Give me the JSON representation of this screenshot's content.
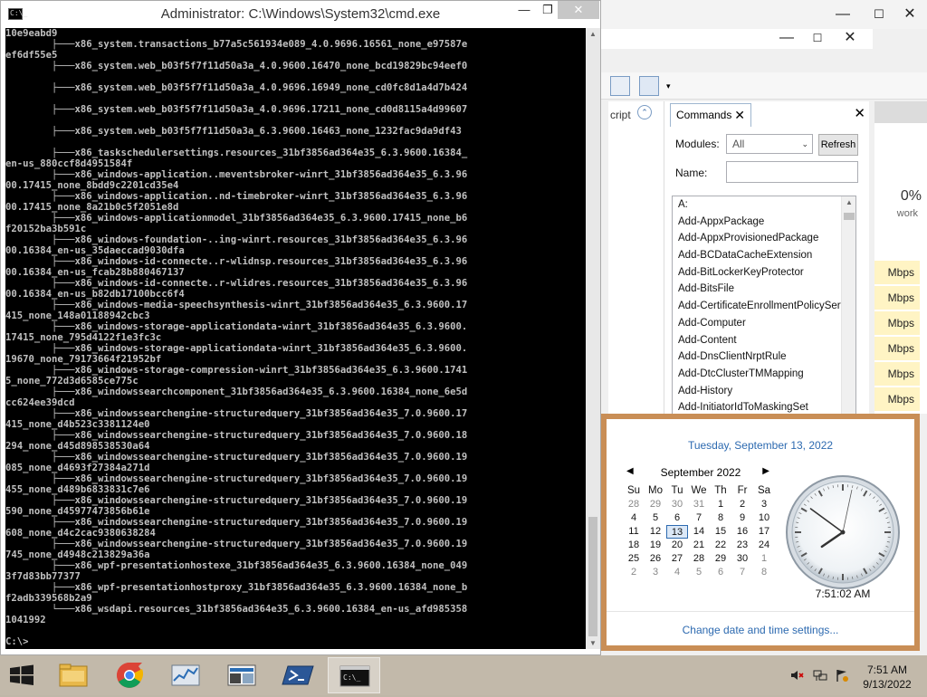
{
  "cmd_window": {
    "title": "Administrator: C:\\Windows\\System32\\cmd.exe",
    "icon_text": "C:\\_",
    "lines": [
      "10e9eabd9",
      "        ├───x86_system.transactions_b77a5c561934e089_4.0.9696.16561_none_e97587e",
      "ef6df55e5",
      "        ├───x86_system.web_b03f5f7f11d50a3a_4.0.9600.16470_none_bcd19829bc94eef0",
      "",
      "        ├───x86_system.web_b03f5f7f11d50a3a_4.0.9696.16949_none_cd0fc8d1a4d7b424",
      "",
      "        ├───x86_system.web_b03f5f7f11d50a3a_4.0.9696.17211_none_cd0d8115a4d99607",
      "",
      "        ├───x86_system.web_b03f5f7f11d50a3a_6.3.9600.16463_none_1232fac9da9df43",
      "",
      "        ├───x86_taskschedulersettings.resources_31bf3856ad364e35_6.3.9600.16384_",
      "en-us_880ccf8d4951584f",
      "        ├───x86_windows-application..meventsbroker-winrt_31bf3856ad364e35_6.3.96",
      "00.17415_none_8bdd9c2201cd35e4",
      "        ├───x86_windows-application..nd-timebroker-winrt_31bf3856ad364e35_6.3.96",
      "00.17415_none_8a21b0c5f2051e8d",
      "        ├───x86_windows-applicationmodel_31bf3856ad364e35_6.3.9600.17415_none_b6",
      "f20152ba3b591c",
      "        ├───x86_windows-foundation-..ing-winrt.resources_31bf3856ad364e35_6.3.96",
      "00.16384_en-us_35daeccad9030dfa",
      "        ├───x86_windows-id-connecte..r-wlidnsp.resources_31bf3856ad364e35_6.3.96",
      "00.16384_en-us_fcab28b880467137",
      "        ├───x86_windows-id-connecte..r-wlidres.resources_31bf3856ad364e35_6.3.96",
      "00.16384_en-us_b82db17100bcc6f4",
      "        ├───x86_windows-media-speechsynthesis-winrt_31bf3856ad364e35_6.3.9600.17",
      "415_none_148a01188942cbc3",
      "        ├───x86_windows-storage-applicationdata-winrt_31bf3856ad364e35_6.3.9600.",
      "17415_none_795d4122f1e3fc3c",
      "        ├───x86_windows-storage-applicationdata-winrt_31bf3856ad364e35_6.3.9600.",
      "19670_none_79173664f21952bf",
      "        ├───x86_windows-storage-compression-winrt_31bf3856ad364e35_6.3.9600.1741",
      "5_none_772d3d6585ce775c",
      "        ├───x86_windowssearchcomponent_31bf3856ad364e35_6.3.9600.16384_none_6e5d",
      "cc624ee39dcd",
      "        ├───x86_windowssearchengine-structuredquery_31bf3856ad364e35_7.0.9600.17",
      "415_none_d4b523c3381124e0",
      "        ├───x86_windowssearchengine-structuredquery_31bf3856ad364e35_7.0.9600.18",
      "294_none_d45d898538530a64",
      "        ├───x86_windowssearchengine-structuredquery_31bf3856ad364e35_7.0.9600.19",
      "085_none_d4693f27384a271d",
      "        ├───x86_windowssearchengine-structuredquery_31bf3856ad364e35_7.0.9600.19",
      "455_none_d489b6833831c7e6",
      "        ├───x86_windowssearchengine-structuredquery_31bf3856ad364e35_7.0.9600.19",
      "590_none_d45977473856b61e",
      "        ├───x86_windowssearchengine-structuredquery_31bf3856ad364e35_7.0.9600.19",
      "608_none_d4c2cac9380638284",
      "        ├───x86_windowssearchengine-structuredquery_31bf3856ad364e35_7.0.9600.19",
      "745_none_d4948c213829a36a",
      "        ├───x86_wpf-presentationhostexe_31bf3856ad364e35_6.3.9600.16384_none_049",
      "3f7d83bb77377",
      "        ├───x86_wpf-presentationhostproxy_31bf3856ad364e35_6.3.9600.16384_none_b",
      "f2adb339568b2a9",
      "        └───x86_wsdapi.resources_31bf3856ad364e35_6.3.9600.16384_en-us_afd985358",
      "1041992",
      "",
      "C:\\>"
    ]
  },
  "ise": {
    "left_tab_label": "cript",
    "commands_tab_label": "Commands",
    "modules_label": "Modules:",
    "modules_value": "All",
    "refresh_label": "Refresh",
    "name_label": "Name:",
    "name_value": "",
    "commands": [
      "A:",
      "Add-AppxPackage",
      "Add-AppxProvisionedPackage",
      "Add-BCDataCacheExtension",
      "Add-BitLockerKeyProtector",
      "Add-BitsFile",
      "Add-CertificateEnrollmentPolicyServe",
      "Add-Computer",
      "Add-Content",
      "Add-DnsClientNrptRule",
      "Add-DtcClusterTMMapping",
      "Add-History",
      "Add-InitiatorIdToMaskingSet"
    ],
    "right_percent": "0%",
    "right_network_label": "work",
    "mbps": [
      "Mbps",
      "Mbps",
      "Mbps",
      "Mbps",
      "Mbps",
      "Mbps"
    ]
  },
  "clock_flyout": {
    "long_date": "Tuesday, September 13, 2022",
    "month_title": "September 2022",
    "weekdays": [
      "Su",
      "Mo",
      "Tu",
      "We",
      "Th",
      "Fr",
      "Sa"
    ],
    "days": [
      {
        "d": "28",
        "other": true
      },
      {
        "d": "29",
        "other": true
      },
      {
        "d": "30",
        "other": true
      },
      {
        "d": "31",
        "other": true
      },
      {
        "d": "1"
      },
      {
        "d": "2"
      },
      {
        "d": "3"
      },
      {
        "d": "4"
      },
      {
        "d": "5"
      },
      {
        "d": "6"
      },
      {
        "d": "7"
      },
      {
        "d": "8"
      },
      {
        "d": "9"
      },
      {
        "d": "10"
      },
      {
        "d": "11"
      },
      {
        "d": "12"
      },
      {
        "d": "13",
        "today": true
      },
      {
        "d": "14"
      },
      {
        "d": "15"
      },
      {
        "d": "16"
      },
      {
        "d": "17"
      },
      {
        "d": "18"
      },
      {
        "d": "19"
      },
      {
        "d": "20"
      },
      {
        "d": "21"
      },
      {
        "d": "22"
      },
      {
        "d": "23"
      },
      {
        "d": "24"
      },
      {
        "d": "25"
      },
      {
        "d": "26"
      },
      {
        "d": "27"
      },
      {
        "d": "28"
      },
      {
        "d": "29"
      },
      {
        "d": "30"
      },
      {
        "d": "1",
        "other": true
      },
      {
        "d": "2",
        "other": true
      },
      {
        "d": "3",
        "other": true
      },
      {
        "d": "4",
        "other": true
      },
      {
        "d": "5",
        "other": true
      },
      {
        "d": "6",
        "other": true
      },
      {
        "d": "7",
        "other": true
      },
      {
        "d": "8",
        "other": true
      }
    ],
    "time": "7:51:02 AM",
    "analog": {
      "hour": 7,
      "minute": 51,
      "second": 2
    },
    "settings_link": "Change date and time settings..."
  },
  "taskbar": {
    "items": [
      "start-button",
      "file-explorer",
      "chrome",
      "performance-monitor",
      "server-manager",
      "powershell",
      "command-prompt"
    ],
    "active_item": "command-prompt",
    "tray_time": "7:51 AM",
    "tray_date": "9/13/2022"
  },
  "colors": {
    "accent_blue": "#2d6ab0",
    "flyout_border": "#c98e56",
    "taskbar": "#c2b9aa"
  }
}
